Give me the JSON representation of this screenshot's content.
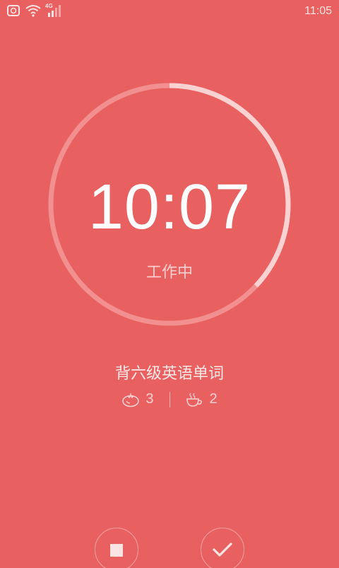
{
  "status_bar": {
    "time": "11:05",
    "network_label": "4G",
    "icons": [
      "alarm-icon",
      "wifi-icon",
      "signal-icon"
    ]
  },
  "timer": {
    "value": "10:07",
    "status": "工作中",
    "elapsed_fraction": 0.37
  },
  "task": {
    "title": "背六级英语单词",
    "tomato_count": "3",
    "break_count": "2"
  },
  "colors": {
    "background": "#e86060",
    "ring_track": "#f29090",
    "ring_progress": "#fbd2d2"
  }
}
